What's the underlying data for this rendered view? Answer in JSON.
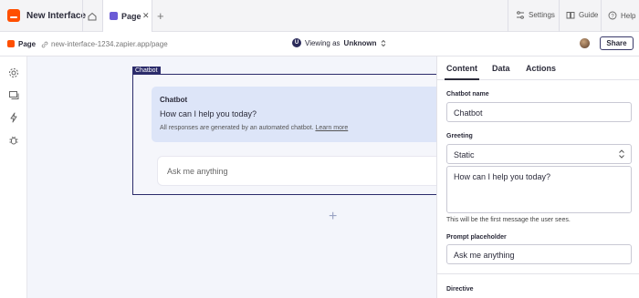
{
  "app": {
    "title": "New Interface"
  },
  "tabs": [
    {
      "label": "Page",
      "close": "✕"
    }
  ],
  "add_tab": "+",
  "top_right": {
    "settings": "Settings",
    "guide": "Guide",
    "help": "Help"
  },
  "page_bar": {
    "page_name": "Page",
    "url": "new-interface-1234.zapier.app/page",
    "viewing_prefix": "Viewing as",
    "viewing_role": "Unknown",
    "viewing_badge": "U",
    "share": "Share"
  },
  "left_rail": [
    "gear-icon",
    "pages-icon",
    "bolt-icon",
    "bug-icon"
  ],
  "canvas": {
    "frame_tag": "Chatbot",
    "bubble_title": "Chatbot",
    "greeting": "How can I help you today?",
    "note": "All responses are generated by an automated chatbot.",
    "learn_more": "Learn more",
    "input_placeholder": "Ask me anything",
    "add_block": "+"
  },
  "panel": {
    "tabs": [
      "Content",
      "Data",
      "Actions"
    ],
    "active_tab": "Content",
    "chatbot_name_label": "Chatbot name",
    "chatbot_name_value": "Chatbot",
    "greeting_label": "Greeting",
    "greeting_type": "Static",
    "greeting_text": "How can I help you today?",
    "greeting_help": "This will be the first message the user sees.",
    "placeholder_label": "Prompt placeholder",
    "placeholder_value": "Ask me anything",
    "directive_label": "Directive"
  },
  "colors": {
    "brand": "#ff4f00",
    "accent": "#2b2b6a",
    "bubble": "#dde5f8"
  }
}
